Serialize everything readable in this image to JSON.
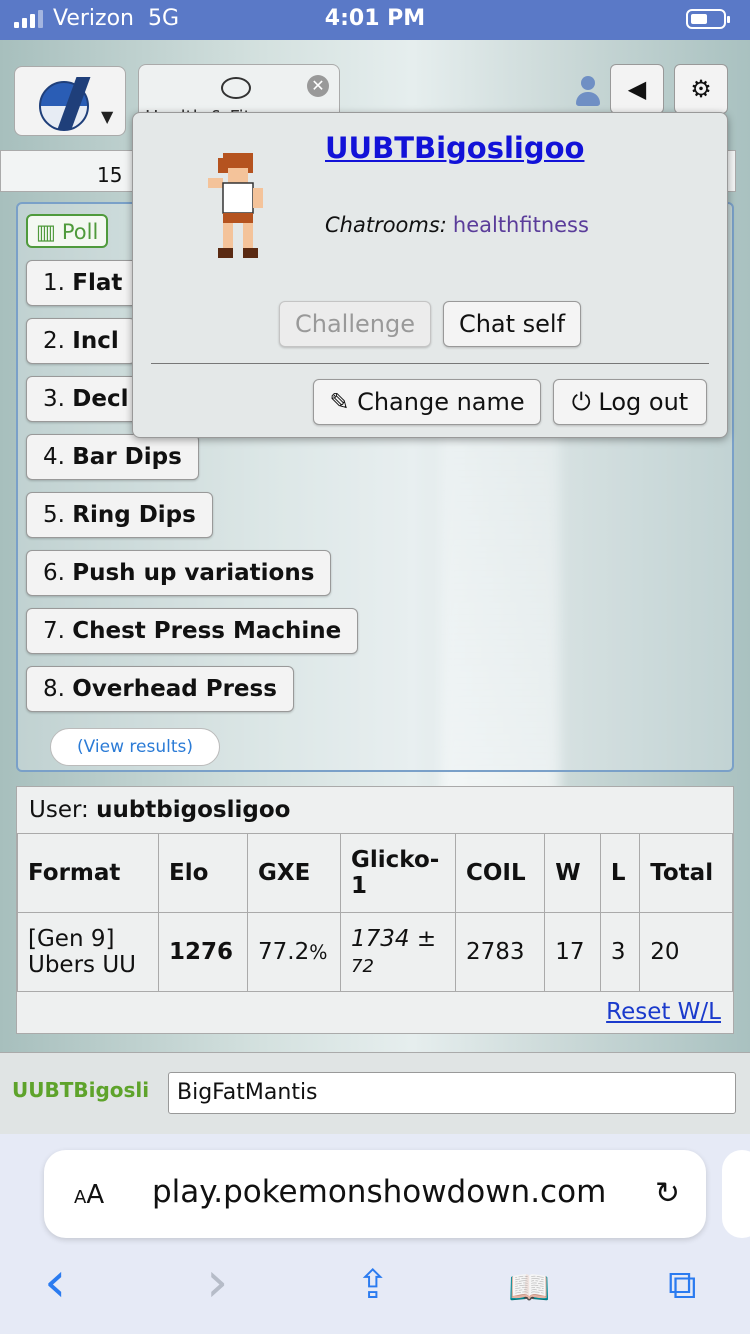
{
  "status": {
    "carrier": "Verizon",
    "network": "5G",
    "time": "4:01 PM"
  },
  "header": {
    "room_tab_label": "Health & Fitness",
    "close_glyph": "✕",
    "sound_glyph": "◀",
    "settings_glyph": "⚙"
  },
  "room": {
    "strip_number": "15"
  },
  "poll": {
    "tag_label": "Poll",
    "options": [
      {
        "num": "1.",
        "label": "Flat"
      },
      {
        "num": "2.",
        "label": "Incl"
      },
      {
        "num": "3.",
        "label": "Decl"
      },
      {
        "num": "4.",
        "label": "Bar Dips"
      },
      {
        "num": "5.",
        "label": "Ring Dips"
      },
      {
        "num": "6.",
        "label": "Push up variations"
      },
      {
        "num": "7.",
        "label": "Chest Press Machine"
      },
      {
        "num": "8.",
        "label": "Overhead Press"
      }
    ],
    "view_results": "(View results)"
  },
  "stats": {
    "user_label": "User:",
    "username": "uubtbigosligoo",
    "headers": [
      "Format",
      "Elo",
      "GXE",
      "Glicko-1",
      "COIL",
      "W",
      "L",
      "Total"
    ],
    "row": {
      "format": "[Gen 9] Ubers UU",
      "elo": "1276",
      "gxe": "77.2",
      "gxe_unit": "%",
      "glicko": "1734",
      "glicko_pm": "±",
      "glicko_dev": "72",
      "coil": "2783",
      "w": "17",
      "l": "3",
      "total": "20"
    },
    "reset": "Reset W/L"
  },
  "chat": {
    "name": "UUBTBigosli",
    "input_value": "BigFatMantis"
  },
  "popup": {
    "username": "UUBTBigosligoo",
    "chatrooms_label": "Chatrooms:",
    "chatroom": "healthfitness",
    "challenge": "Challenge",
    "chat_self": "Chat self",
    "change_name": "Change name",
    "log_out": "Log out"
  },
  "safari": {
    "aa": "AA",
    "url": "play.pokemonshowdown.com",
    "reload_glyph": "↻",
    "back_glyph": "‹",
    "forward_glyph": "›",
    "share_glyph": "⇪",
    "bookmarks_glyph": "📖",
    "tabs_glyph": "⧉"
  },
  "colors": {
    "status_bar": "#5a79c7",
    "link": "#1212d8",
    "chat_name": "#5ea32b",
    "poll_border": "#4f9a3c"
  }
}
